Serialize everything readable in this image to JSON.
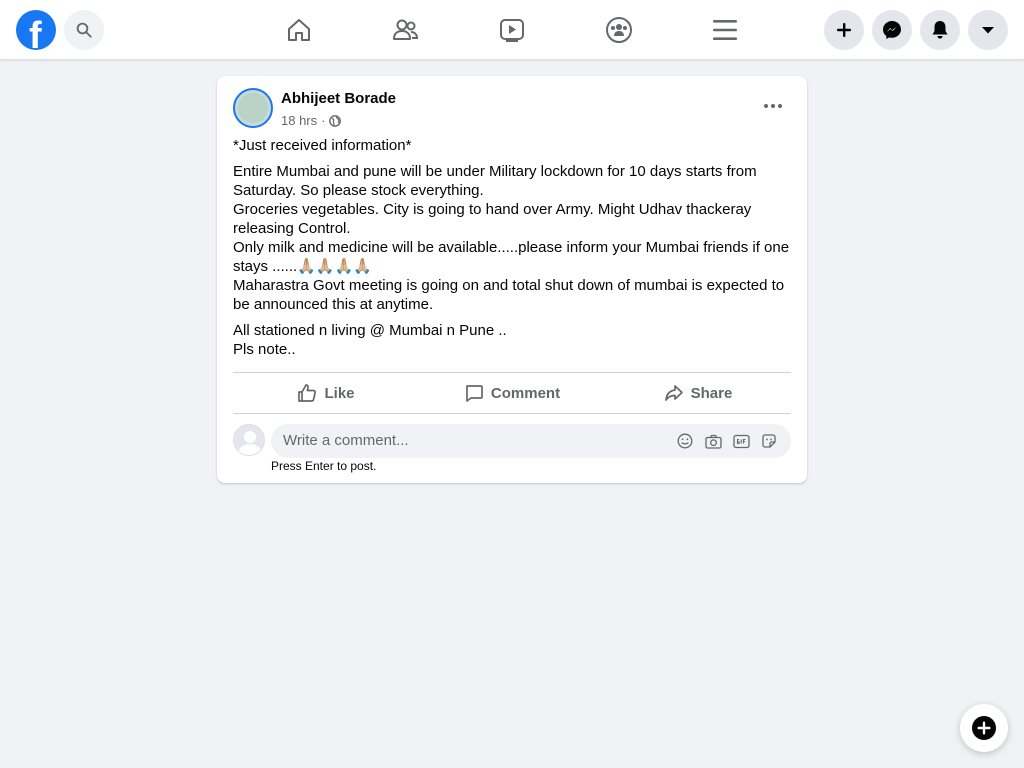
{
  "topbar": {
    "logo_letter": "f",
    "icons": {
      "search": "search-icon",
      "home": "home-icon",
      "friends": "friends-icon",
      "watch": "watch-icon",
      "groups": "groups-icon",
      "menu": "menu-icon",
      "create": "plus-icon",
      "messenger": "messenger-icon",
      "notifications": "bell-icon",
      "account": "caret-down-icon"
    }
  },
  "post": {
    "author": "Abhijeet Borade",
    "time": "18 hrs",
    "separator": "·",
    "paragraphs": [
      "*Just received information*",
      "Entire Mumbai and pune  will be under Military lockdown for 10 days starts from Saturday. So please stock everything.\nGroceries vegetables. City is going to hand over Army. Might Udhav thackeray releasing Control.\nOnly milk and medicine will be available.....please inform your Mumbai friends if one stays ......🙏🏼🙏🏼🙏🏼🙏🏼\n Maharastra Govt meeting is going on  and total shut down of mumbai is expected to be announced this at anytime.",
      "All stationed n living @ Mumbai n Pune ..\nPls note.."
    ],
    "actions": {
      "like": "Like",
      "comment": "Comment",
      "share": "Share"
    }
  },
  "comment": {
    "placeholder": "Write a comment...",
    "hint": "Press Enter to post."
  },
  "colors": {
    "brand": "#1877f2",
    "muted_text": "#65676b",
    "background": "#f0f2f5"
  }
}
